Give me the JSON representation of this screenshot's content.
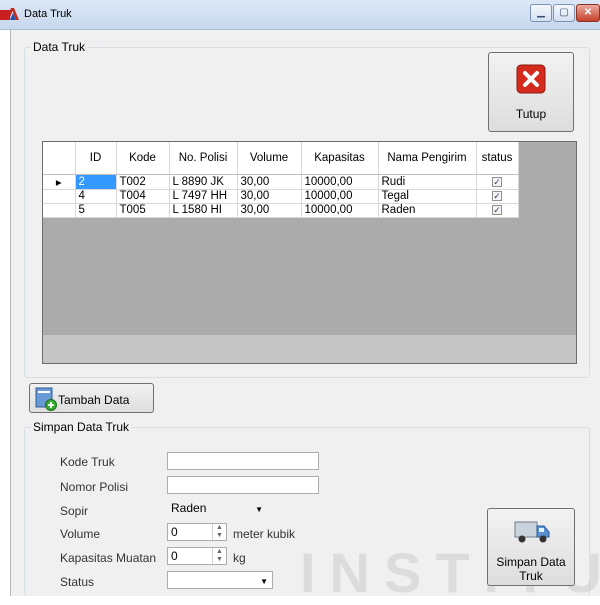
{
  "window": {
    "title": "Data Truk"
  },
  "top_group": {
    "legend": "Data Truk"
  },
  "close_button": {
    "label": "Tutup"
  },
  "grid": {
    "columns": [
      "ID",
      "Kode",
      "No. Polisi",
      "Volume",
      "Kapasitas",
      "Nama Pengirim",
      "status"
    ],
    "rows": [
      {
        "id": "2",
        "kode": "T002",
        "polisi": "L 8890 JK",
        "volume": "30,00",
        "kapasitas": "10000,00",
        "pengirim": "Rudi",
        "status": true,
        "current": true
      },
      {
        "id": "4",
        "kode": "T004",
        "polisi": "L 7497 HH",
        "volume": "30,00",
        "kapasitas": "10000,00",
        "pengirim": "Tegal",
        "status": true,
        "current": false
      },
      {
        "id": "5",
        "kode": "T005",
        "polisi": "L 1580 HI",
        "volume": "30,00",
        "kapasitas": "10000,00",
        "pengirim": "Raden",
        "status": true,
        "current": false
      }
    ]
  },
  "add_button": {
    "label": "Tambah Data"
  },
  "form": {
    "legend": "Simpan Data Truk",
    "kode_label": "Kode Truk",
    "kode_value": "",
    "nomor_label": "Nomor Polisi",
    "nomor_value": "",
    "sopir_label": "Sopir",
    "sopir_value": "Raden",
    "volume_label": "Volume",
    "volume_value": "0",
    "volume_unit": "meter kubik",
    "kapasitas_label": "Kapasitas Muatan",
    "kapasitas_value": "0",
    "kapasitas_unit": "kg",
    "status_label": "Status",
    "status_value": ""
  },
  "save_button": {
    "label_line1": "Simpan Data",
    "label_line2": "Truk"
  },
  "watermark": {
    "text": "INSTITUT"
  }
}
